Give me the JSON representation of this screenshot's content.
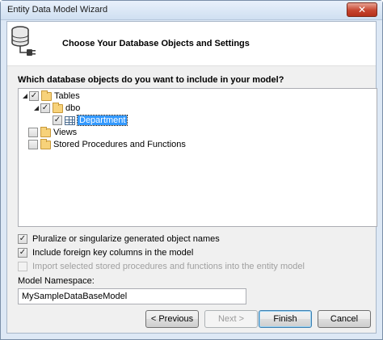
{
  "window": {
    "title": "Entity Data Model Wizard",
    "close_glyph": "✕"
  },
  "header": {
    "title": "Choose Your Database Objects and Settings",
    "icon": "database-plug-icon"
  },
  "question": "Which database objects do you want to include in your model?",
  "tree": {
    "tables": {
      "label": "Tables",
      "checked": true,
      "expanded": true
    },
    "dbo": {
      "label": "dbo",
      "checked": true,
      "expanded": true
    },
    "department": {
      "label": "Department",
      "checked": true,
      "selected": true
    },
    "views": {
      "label": "Views",
      "checked": false
    },
    "stored_procedures": {
      "label": "Stored Procedures and Functions",
      "checked": false
    }
  },
  "options": {
    "pluralize": {
      "label": "Pluralize or singularize generated object names",
      "checked": true
    },
    "foreign_keys": {
      "label": "Include foreign key columns in the model",
      "checked": true
    },
    "import_procs": {
      "label": "Import selected stored procedures and functions into the entity model",
      "checked": false,
      "enabled": false
    }
  },
  "namespace": {
    "label": "Model Namespace:",
    "value": "MySampleDataBaseModel"
  },
  "buttons": {
    "previous": "< Previous",
    "next": "Next >",
    "finish": "Finish",
    "cancel": "Cancel"
  },
  "colors": {
    "selection": "#3399ff",
    "window_frame": "#dde8f5",
    "close_button": "#c6452f"
  }
}
